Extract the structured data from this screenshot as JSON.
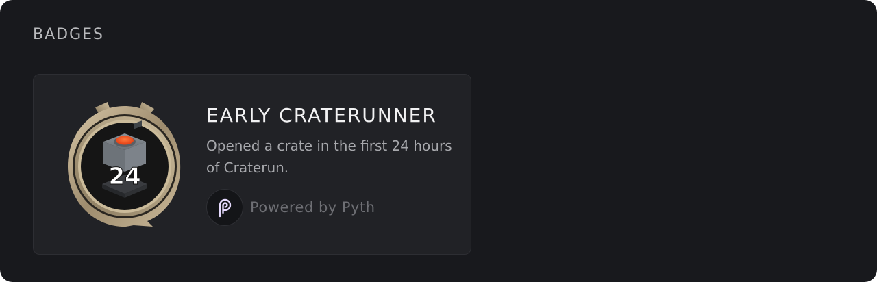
{
  "section": {
    "title": "BADGES"
  },
  "badges": [
    {
      "name": "EARLY CRATERUNNER",
      "description": "Opened a crate in the first 24 hours of Craterun.",
      "medal_number": "24",
      "medal_icon": "crate-medal-icon",
      "powered_by": "Powered by Pyth",
      "powered_icon": "pyth-logo-icon"
    }
  ],
  "colors": {
    "background": "#18191d",
    "card": "#212226",
    "medal_gold": "#b8a68a",
    "crate_button": "#ff5a1f",
    "pyth_purple": "#e6dafe"
  }
}
